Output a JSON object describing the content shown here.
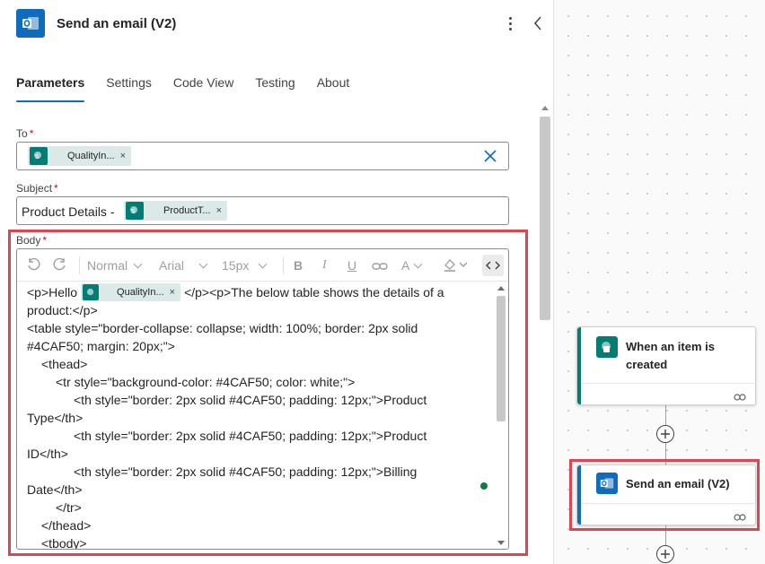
{
  "panel": {
    "title": "Send an email (V2)",
    "icon": "outlook-icon",
    "tabs": [
      {
        "label": "Parameters",
        "active": true
      },
      {
        "label": "Settings",
        "active": false
      },
      {
        "label": "Code View",
        "active": false
      },
      {
        "label": "Testing",
        "active": false
      },
      {
        "label": "About",
        "active": false
      }
    ]
  },
  "fields": {
    "to": {
      "label": "To",
      "required_mark": "*",
      "token": "QualityIn...",
      "token_remove": "×"
    },
    "subject": {
      "label": "Subject",
      "required_mark": "*",
      "prefix": "Product Details -",
      "token": "ProductT...",
      "token_remove": "×"
    },
    "body": {
      "label": "Body",
      "required_mark": "*",
      "toolbar": {
        "format": "Normal",
        "font": "Arial",
        "size": "15px",
        "bold": "B",
        "italic": "I",
        "underline": "U",
        "font_color": "A"
      },
      "line1_before": "<p>Hello",
      "line1_token": "QualityIn...",
      "line1_token_remove": "×",
      "line1_after": "</p><p>The below table shows the details of a",
      "lines": [
        "product:</p>",
        "<table style=\"border-collapse: collapse; width: 100%; border: 2px solid",
        "#4CAF50; margin: 20px;\">",
        "    <thead>",
        "        <tr style=\"background-color: #4CAF50; color: white;\">",
        "            <th style=\"border: 2px solid #4CAF50; padding: 12px;\">Product",
        "Type</th>",
        "            <th style=\"border: 2px solid #4CAF50; padding: 12px;\">Product",
        "ID</th>",
        "            <th style=\"border: 2px solid #4CAF50; padding: 12px;\">Billing",
        "Date</th>",
        "        </tr>",
        "    </thead>",
        "    <tbody>"
      ]
    }
  },
  "flow": {
    "trigger": {
      "title_line1": "When an item is",
      "title_line2": "created",
      "icon": "sharepoint-icon",
      "color": "#037c73"
    },
    "action": {
      "title": "Send an email (V2)",
      "icon": "outlook-icon",
      "color": "#0f6cbd"
    }
  },
  "colors": {
    "accent": "#0f6cbd",
    "sharepoint": "#037c73",
    "highlight": "#e0454f",
    "required": "#c50f1f"
  }
}
